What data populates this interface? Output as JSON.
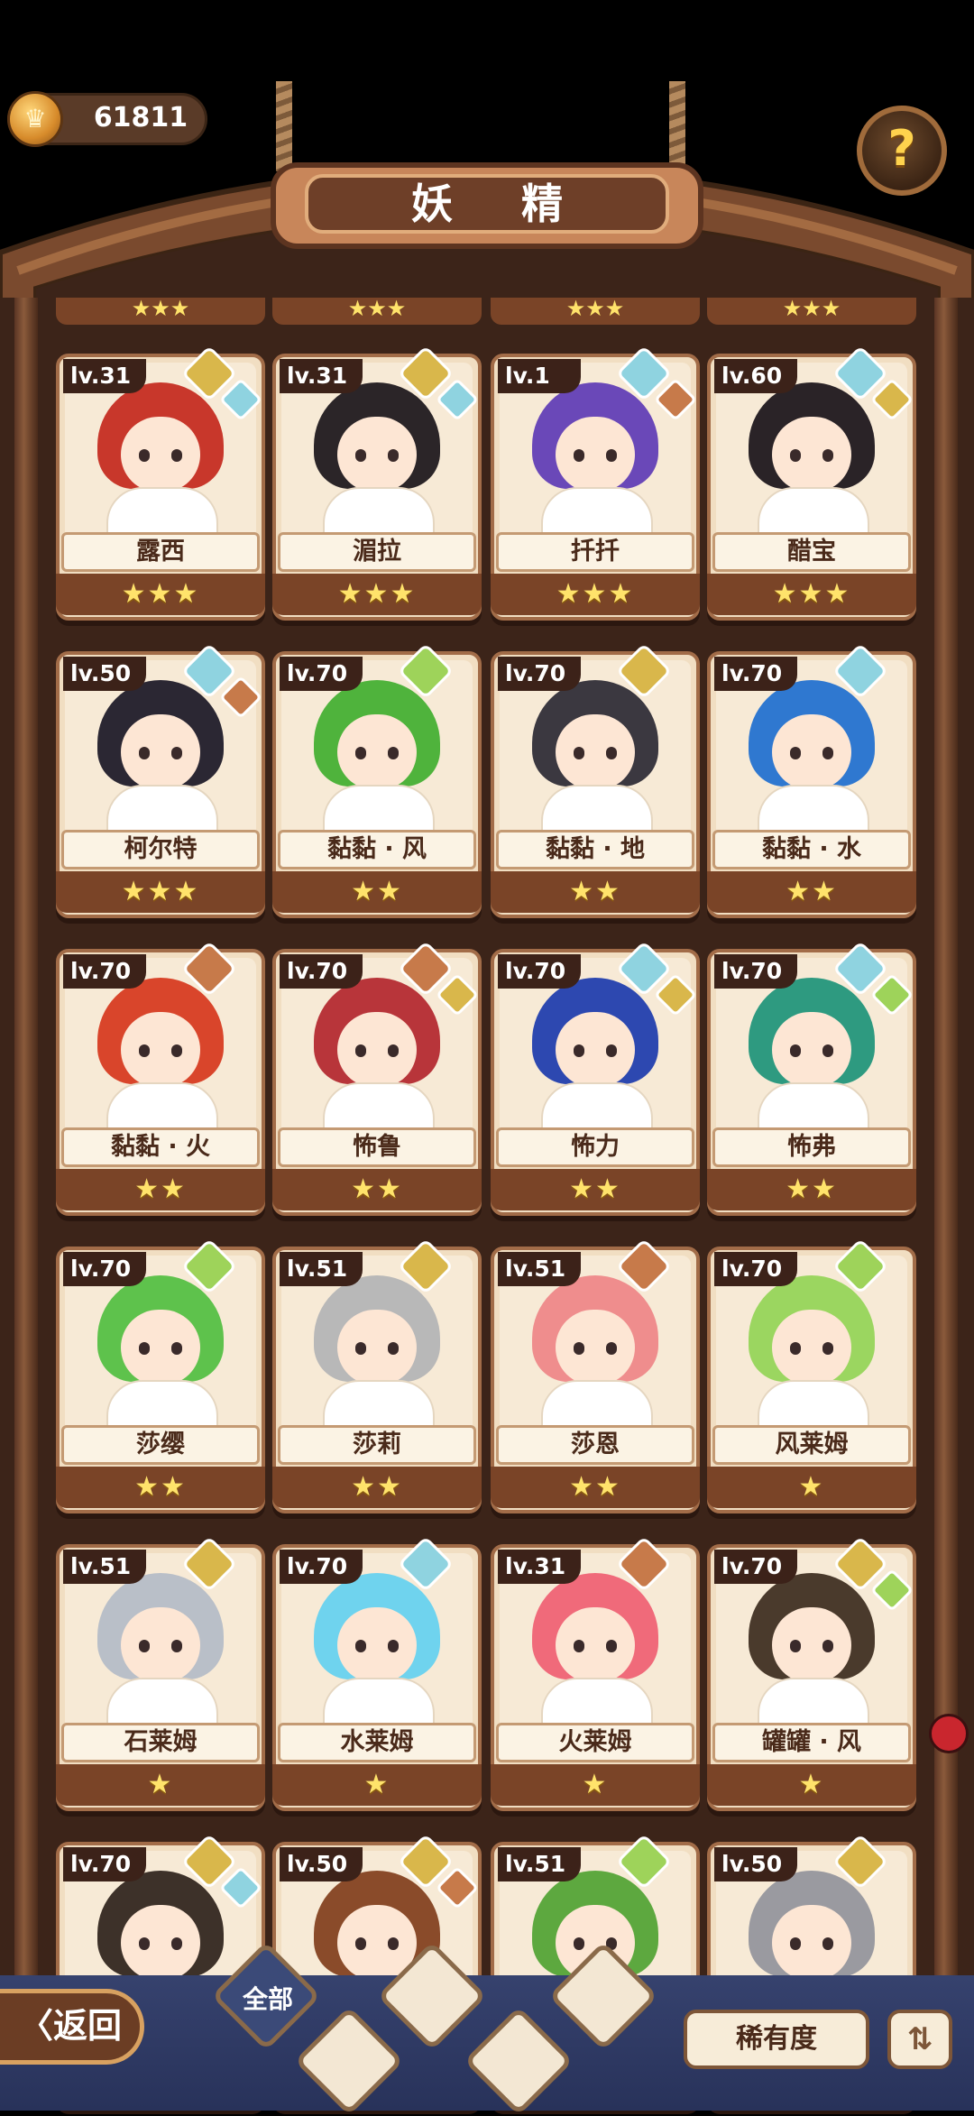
{
  "header": {
    "coins": "61811",
    "coin_icon": "crown-coin-icon",
    "help_icon": "question-sprout-icon",
    "help_symbol": "?",
    "title": "妖 精"
  },
  "colors": {
    "wood_dark": "#3c2419",
    "card_bg": "#f1dec2",
    "star": "#ffe36b",
    "earth": "#d9b74b",
    "water": "#8fd3e0",
    "wind": "#9ed35a",
    "fire": "#c77a4a"
  },
  "cards": [
    {
      "level": "lv.31",
      "name": "露西",
      "stars": "★★★",
      "rarity": 3,
      "elements": [
        "earth",
        "water"
      ],
      "hair": "#c8372b"
    },
    {
      "level": "lv.31",
      "name": "湄拉",
      "stars": "★★★",
      "rarity": 3,
      "elements": [
        "earth",
        "water"
      ],
      "hair": "#2b2528"
    },
    {
      "level": "lv.1",
      "name": "扦扦",
      "stars": "★★★",
      "rarity": 3,
      "elements": [
        "water",
        "fire"
      ],
      "hair": "#6a48b8"
    },
    {
      "level": "lv.60",
      "name": "醋宝",
      "stars": "★★★",
      "rarity": 3,
      "elements": [
        "water",
        "earth"
      ],
      "hair": "#2a2327"
    },
    {
      "level": "lv.50",
      "name": "柯尔特",
      "stars": "★★★",
      "rarity": 3,
      "elements": [
        "water",
        "fire"
      ],
      "hair": "#2b2733"
    },
    {
      "level": "lv.70",
      "name": "黏黏 · 风",
      "stars": "★★",
      "rarity": 2,
      "elements": [
        "wind"
      ],
      "hair": "#4fb33c"
    },
    {
      "level": "lv.70",
      "name": "黏黏 · 地",
      "stars": "★★",
      "rarity": 2,
      "elements": [
        "earth"
      ],
      "hair": "#3b3840"
    },
    {
      "level": "lv.70",
      "name": "黏黏 · 水",
      "stars": "★★",
      "rarity": 2,
      "elements": [
        "water"
      ],
      "hair": "#2f78d0"
    },
    {
      "level": "lv.70",
      "name": "黏黏 · 火",
      "stars": "★★",
      "rarity": 2,
      "elements": [
        "fire"
      ],
      "hair": "#d9452b"
    },
    {
      "level": "lv.70",
      "name": "怖鲁",
      "stars": "★★",
      "rarity": 2,
      "elements": [
        "fire",
        "earth"
      ],
      "hair": "#b8353a"
    },
    {
      "level": "lv.70",
      "name": "怖力",
      "stars": "★★",
      "rarity": 2,
      "elements": [
        "water",
        "earth"
      ],
      "hair": "#2d48b0"
    },
    {
      "level": "lv.70",
      "name": "怖弗",
      "stars": "★★",
      "rarity": 2,
      "elements": [
        "water",
        "wind"
      ],
      "hair": "#2e9a80"
    },
    {
      "level": "lv.70",
      "name": "莎缨",
      "stars": "★★",
      "rarity": 2,
      "elements": [
        "wind"
      ],
      "hair": "#5ec24c"
    },
    {
      "level": "lv.51",
      "name": "莎莉",
      "stars": "★★",
      "rarity": 2,
      "elements": [
        "earth"
      ],
      "hair": "#b8b8b8"
    },
    {
      "level": "lv.51",
      "name": "莎恩",
      "stars": "★★",
      "rarity": 2,
      "elements": [
        "fire"
      ],
      "hair": "#ef8d8d"
    },
    {
      "level": "lv.70",
      "name": "风莱姆",
      "stars": "★",
      "rarity": 1,
      "elements": [
        "wind"
      ],
      "hair": "#9bd660"
    },
    {
      "level": "lv.51",
      "name": "石莱姆",
      "stars": "★",
      "rarity": 1,
      "elements": [
        "earth"
      ],
      "hair": "#b9bfc8"
    },
    {
      "level": "lv.70",
      "name": "水莱姆",
      "stars": "★",
      "rarity": 1,
      "elements": [
        "water"
      ],
      "hair": "#6fd3ee"
    },
    {
      "level": "lv.31",
      "name": "火莱姆",
      "stars": "★",
      "rarity": 1,
      "elements": [
        "fire"
      ],
      "hair": "#f06a7a"
    },
    {
      "level": "lv.70",
      "name": "罐罐 · 风",
      "stars": "★",
      "rarity": 1,
      "elements": [
        "earth",
        "wind"
      ],
      "hair": "#4a3a2c"
    },
    {
      "level": "lv.70",
      "name": "",
      "stars": "",
      "rarity": 0,
      "elements": [
        "earth",
        "water"
      ],
      "hair": "#3d3129"
    },
    {
      "level": "lv.50",
      "name": "",
      "stars": "",
      "rarity": 0,
      "elements": [
        "earth",
        "fire"
      ],
      "hair": "#8a4b2a"
    },
    {
      "level": "lv.51",
      "name": "",
      "stars": "",
      "rarity": 0,
      "elements": [
        "wind"
      ],
      "hair": "#5da83f"
    },
    {
      "level": "lv.50",
      "name": "",
      "stars": "",
      "rarity": 0,
      "elements": [
        "earth"
      ],
      "hair": "#9a9aa0"
    }
  ],
  "bottom": {
    "back_label": "〈返回",
    "tabs": [
      {
        "label": "全部",
        "icon": "all-tab-icon"
      },
      {
        "label": "",
        "icon": "wind-sprout-icon"
      },
      {
        "label": "",
        "icon": "water-drop-icon"
      },
      {
        "label": "",
        "icon": "earth-mountain-icon"
      },
      {
        "label": "",
        "icon": "fire-crystal-icon"
      }
    ],
    "rarity_label": "稀有度",
    "sort_symbol": "⇅"
  }
}
